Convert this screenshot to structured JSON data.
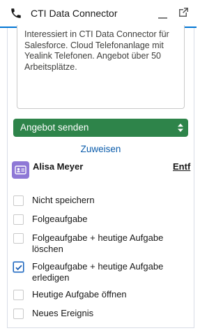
{
  "header": {
    "title": "CTI Data Connector",
    "phone_icon": "phone-icon",
    "minimize_icon": "minimize-icon",
    "popout_icon": "popout-icon",
    "accent_color": "#0176d3"
  },
  "note": {
    "text": "Interessiert in CTI Data Connector für Salesforce. Cloud Telefonanlage mit Yealink Telefonen. Angebot über 50 Arbeitsplätze."
  },
  "action": {
    "selected": "Angebot senden",
    "color": "#2e844a"
  },
  "assign_label": "Zuweisen",
  "contact": {
    "name": "Alisa Meyer",
    "remove_label": "Entf",
    "icon": "contact-card-icon",
    "icon_color": "#8e78d6"
  },
  "options": [
    {
      "label": "Nicht speichern",
      "checked": false
    },
    {
      "label": "Folgeaufgabe",
      "checked": false
    },
    {
      "label": "Folgeaufgabe + heutige Aufgabe löschen",
      "checked": false
    },
    {
      "label": "Folgeaufgabe + heutige Aufgabe erledigen",
      "checked": true
    },
    {
      "label": "Heutige Aufgabe öffnen",
      "checked": false
    },
    {
      "label": "Neues Ereignis",
      "checked": false
    }
  ]
}
